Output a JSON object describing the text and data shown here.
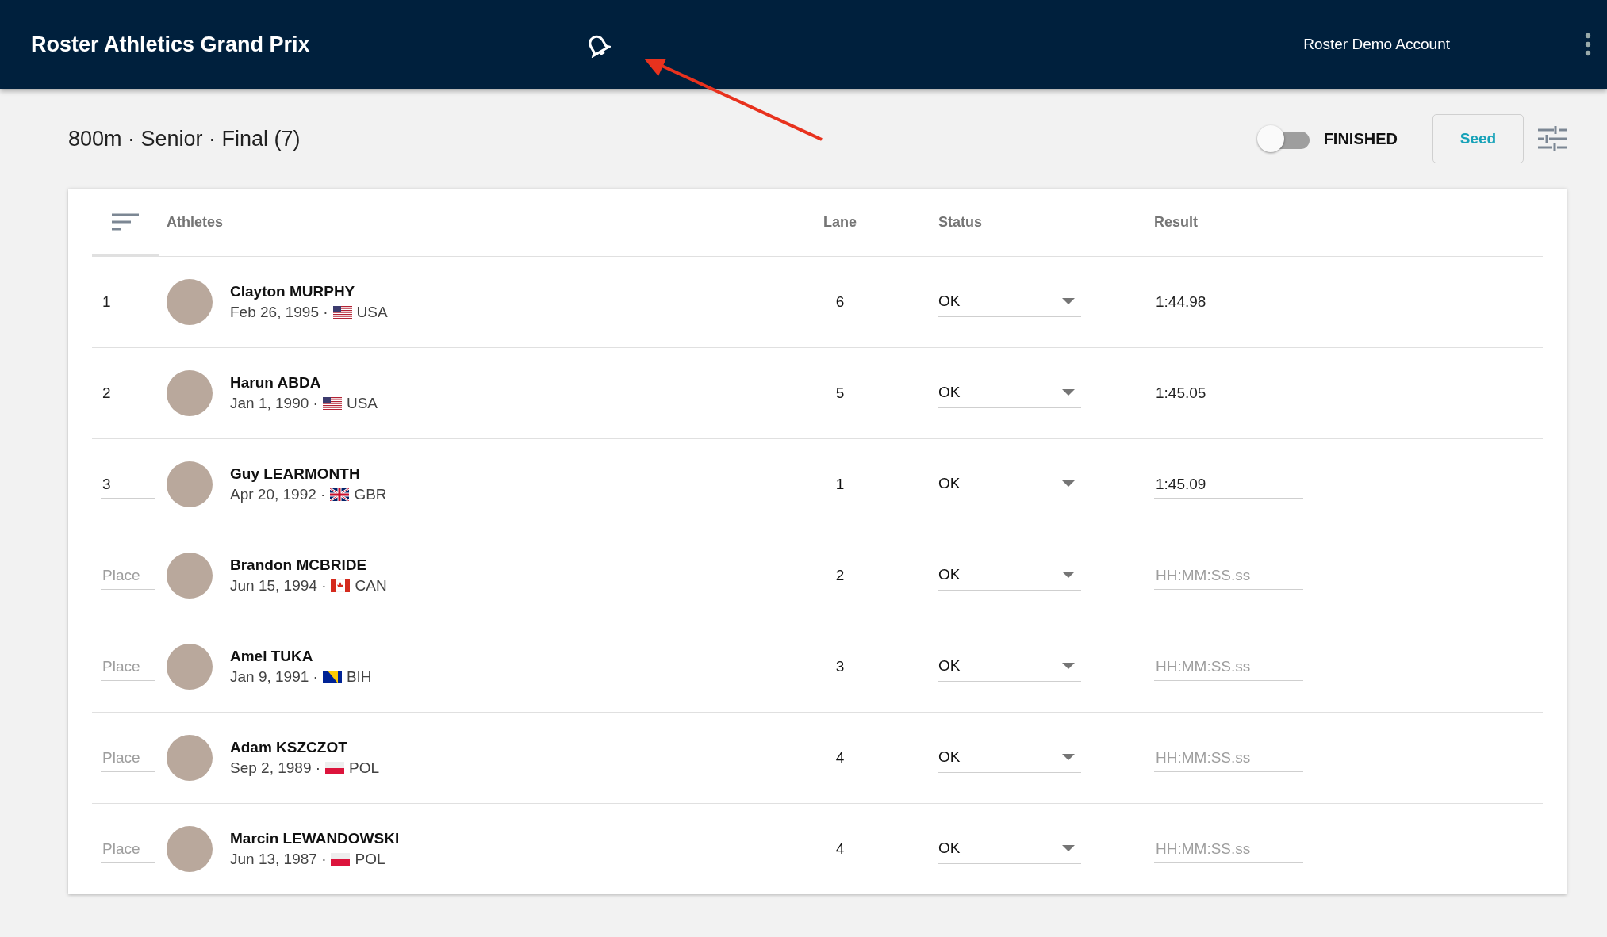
{
  "app_bar": {
    "title": "Roster Athletics Grand Prix",
    "account": "Roster Demo Account"
  },
  "event": {
    "title": "800m · Senior · Final (7)",
    "finished_label": "FINISHED",
    "finished_on": false,
    "seed_button": "Seed"
  },
  "table": {
    "columns": [
      "Athletes",
      "Lane",
      "Status",
      "Result"
    ],
    "rows": [
      {
        "place": "1",
        "name": "Clayton MURPHY",
        "born": "Feb 26, 1995 ·",
        "kind": "us",
        "country": "USA",
        "lane": "6",
        "status": "OK",
        "result": "1:44.98"
      },
      {
        "place": "2",
        "name": "Harun ABDA",
        "born": "Jan 1, 1990 ·",
        "kind": "us",
        "country": "USA",
        "lane": "5",
        "status": "OK",
        "result": "1:45.05"
      },
      {
        "place": "3",
        "name": "Guy LEARMONTH",
        "born": "Apr 20, 1992 ·",
        "kind": "gb",
        "country": "GBR",
        "lane": "1",
        "status": "OK",
        "result": "1:45.09"
      },
      {
        "place_placeholder": "Place",
        "name": "Brandon MCBRIDE",
        "born": "Jun 15, 1994 ·",
        "kind": "ca",
        "country": "CAN",
        "lane": "2",
        "status": "OK",
        "result_placeholder": "HH:MM:SS.ss"
      },
      {
        "place_placeholder": "Place",
        "name": "Amel TUKA",
        "born": "Jan 9, 1991 ·",
        "kind": "ba",
        "country": "BIH",
        "lane": "3",
        "status": "OK",
        "result_placeholder": "HH:MM:SS.ss"
      },
      {
        "place_placeholder": "Place",
        "name": "Adam KSZCZOT",
        "born": "Sep 2, 1989 ·",
        "kind": "pl",
        "country": "POL",
        "lane": "4",
        "status": "OK",
        "result_placeholder": "HH:MM:SS.ss"
      },
      {
        "place_placeholder": "Place",
        "name": "Marcin LEWANDOWSKI",
        "born": "Jun 13, 1987 ·",
        "kind": "pl",
        "country": "POL",
        "lane": "4",
        "status": "OK",
        "result_placeholder": "HH:MM:SS.ss"
      }
    ]
  }
}
